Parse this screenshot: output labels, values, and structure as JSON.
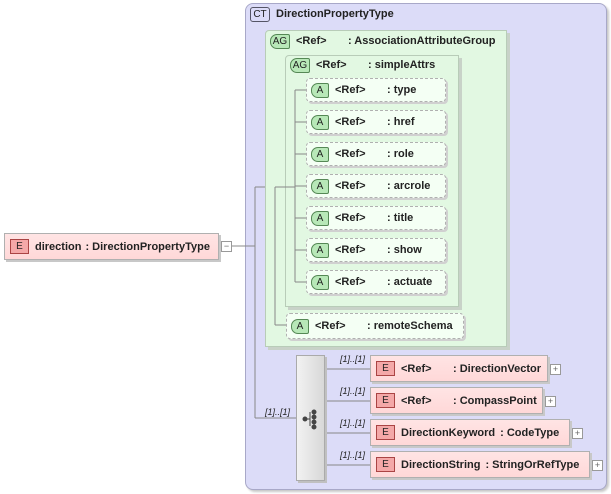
{
  "root": {
    "badge": "E",
    "name": "direction",
    "type": ": DirectionPropertyType",
    "toggle": "−"
  },
  "complexType": {
    "badge": "CT",
    "name": "DirectionPropertyType"
  },
  "outerGroup": {
    "badge": "AG",
    "ref": "<Ref>",
    "type": ": AssociationAttributeGroup"
  },
  "innerGroup": {
    "badge": "AG",
    "ref": "<Ref>",
    "type": ": simpleAttrs"
  },
  "attributes": [
    {
      "badge": "A",
      "ref": "<Ref>",
      "type": ": type"
    },
    {
      "badge": "A",
      "ref": "<Ref>",
      "type": ": href"
    },
    {
      "badge": "A",
      "ref": "<Ref>",
      "type": ": role"
    },
    {
      "badge": "A",
      "ref": "<Ref>",
      "type": ": arcrole"
    },
    {
      "badge": "A",
      "ref": "<Ref>",
      "type": ": title"
    },
    {
      "badge": "A",
      "ref": "<Ref>",
      "type": ": show"
    },
    {
      "badge": "A",
      "ref": "<Ref>",
      "type": ": actuate"
    }
  ],
  "remoteSchema": {
    "badge": "A",
    "ref": "<Ref>",
    "type": ": remoteSchema"
  },
  "choice": {
    "cardinality": "[1]..[1]",
    "icon": "choice-compositor-icon"
  },
  "elements": [
    {
      "badge": "E",
      "name": "<Ref>",
      "type": ": DirectionVector",
      "cardinality": "[1]..[1]",
      "toggle": "+"
    },
    {
      "badge": "E",
      "name": "<Ref>",
      "type": ": CompassPoint",
      "cardinality": "[1]..[1]",
      "toggle": "+"
    },
    {
      "badge": "E",
      "name": "DirectionKeyword",
      "type": ": CodeType",
      "cardinality": "[1]..[1]",
      "toggle": "+"
    },
    {
      "badge": "E",
      "name": "DirectionString",
      "type": ": StringOrRefType",
      "cardinality": "[1]..[1]",
      "toggle": "+"
    }
  ],
  "colors": {
    "complexType": "#dcdcf8",
    "group": "#e2f8e2",
    "element": "#ffdcdc",
    "badgeElement": "#f4a8a8",
    "badgeAttr": "#b8e8b8"
  }
}
